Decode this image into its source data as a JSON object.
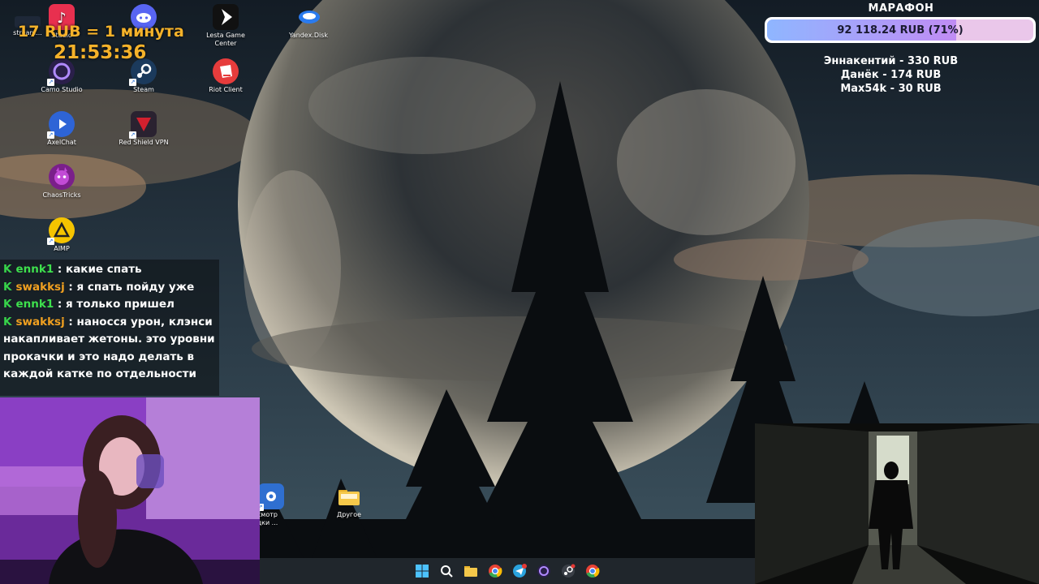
{
  "desktop_icons": [
    {
      "name": "streamlabs",
      "label": "stream..."
    },
    {
      "name": "tiktok",
      "label": "Studio"
    },
    {
      "name": "discord",
      "label": ""
    },
    {
      "name": "lesta",
      "label": "Lesta Game Center"
    },
    {
      "name": "yandex-disk",
      "label": "Yandex.Disk"
    },
    {
      "name": "camo",
      "label": "Camo Studio"
    },
    {
      "name": "steam",
      "label": "Steam"
    },
    {
      "name": "riot",
      "label": "Riot Client"
    },
    {
      "name": "axelchat",
      "label": "AxelChat"
    },
    {
      "name": "redshield",
      "label": "Red Shield VPN"
    },
    {
      "name": "chaostricks",
      "label": "ChaosTricks"
    },
    {
      "name": "aimp",
      "label": "AIMP"
    },
    {
      "name": "control-panel",
      "label": "осмотр\nадки ..."
    },
    {
      "name": "folder-other",
      "label": "Другое"
    }
  ],
  "overlay": {
    "rate": "17 RUB = 1 минута",
    "clock": "21:53:36",
    "marathon_title": "МАРАФОН",
    "marathon_amount": "92 118.24 RUB (71%)",
    "marathon_progress": 0.71,
    "donors": [
      "Эннакентий - 330 RUB",
      "Данёк - 174 RUB",
      "Max54k - 30 RUB"
    ],
    "accent_color": "#f5b22a"
  },
  "chat": [
    {
      "user": "ennk1",
      "color": "#3ee04d",
      "text": "какие спать"
    },
    {
      "user": "swakksj",
      "color": "#f0a020",
      "text": "я спать пойду уже"
    },
    {
      "user": "ennk1",
      "color": "#3ee04d",
      "text": "я только пришел"
    },
    {
      "user": "swakksj",
      "color": "#f0a020",
      "text": "наносся урон, клэнси накапливает жетоны. это уровни прокачки и это надо делать в каждой катке по отдельности"
    }
  ],
  "chat_badge": "K",
  "taskbar": [
    "start",
    "search",
    "file-explorer",
    "chrome",
    "telegram",
    "obs",
    "steam-tray",
    "chrome-2"
  ]
}
